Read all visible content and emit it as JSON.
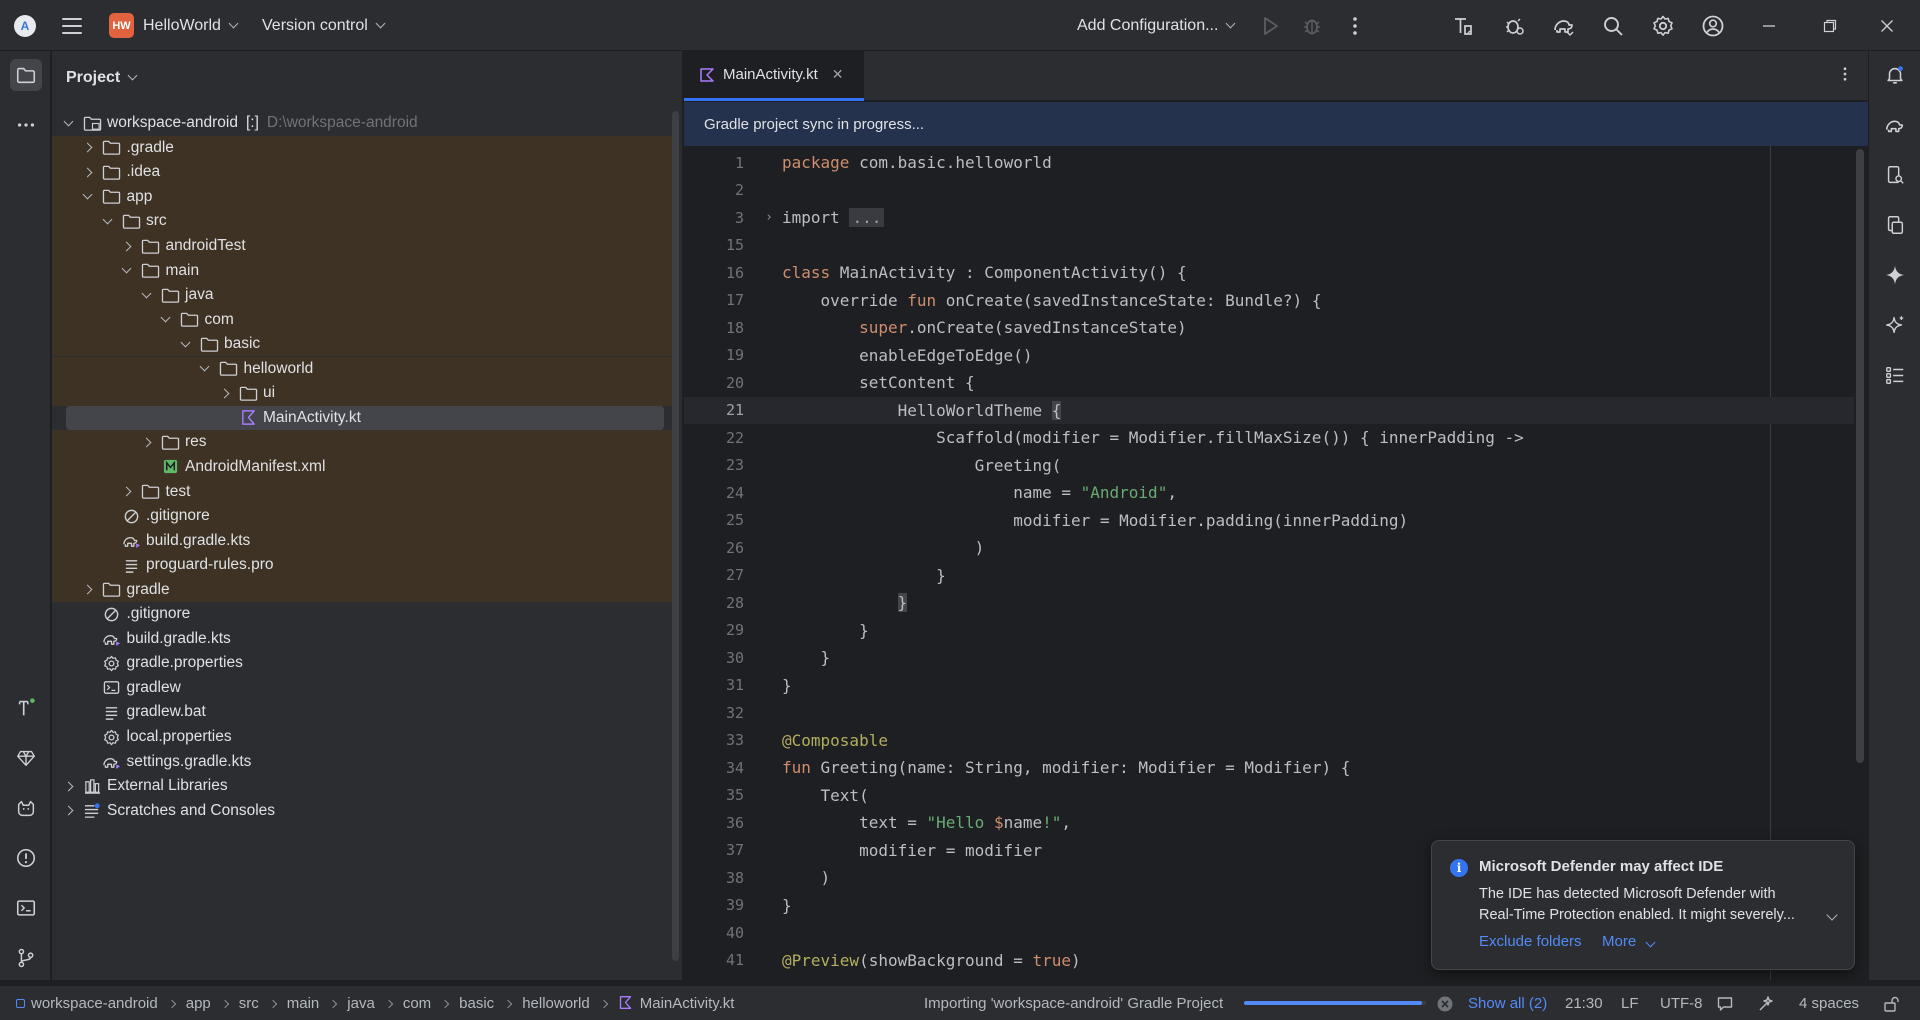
{
  "titlebar": {
    "project_badge": "HW",
    "project_name": "HelloWorld",
    "vcs_label": "Version control",
    "run_config": "Add Configuration..."
  },
  "project_panel": {
    "title": "Project",
    "tree": [
      {
        "label": "workspace-android",
        "suffix": "[:]",
        "hint": "D:\\workspace-android",
        "depth": 0,
        "expanded": true,
        "icon": "module-folder-icon",
        "brown": false
      },
      {
        "label": ".gradle",
        "depth": 1,
        "expanded": false,
        "icon": "folder-icon",
        "brown": true
      },
      {
        "label": ".idea",
        "depth": 1,
        "expanded": false,
        "icon": "folder-icon",
        "brown": true
      },
      {
        "label": "app",
        "depth": 1,
        "expanded": true,
        "icon": "folder-icon",
        "brown": true
      },
      {
        "label": "src",
        "depth": 2,
        "expanded": true,
        "icon": "folder-icon",
        "brown": true
      },
      {
        "label": "androidTest",
        "depth": 3,
        "expanded": false,
        "icon": "folder-icon",
        "brown": true
      },
      {
        "label": "main",
        "depth": 3,
        "expanded": true,
        "icon": "folder-icon",
        "brown": true
      },
      {
        "label": "java",
        "depth": 4,
        "expanded": true,
        "icon": "folder-icon",
        "brown": true
      },
      {
        "label": "com",
        "depth": 5,
        "expanded": true,
        "icon": "folder-icon",
        "brown": true
      },
      {
        "label": "basic",
        "depth": 6,
        "expanded": true,
        "icon": "folder-icon",
        "brown": true
      },
      {
        "label": "helloworld",
        "depth": 7,
        "expanded": true,
        "icon": "folder-icon",
        "brown": true
      },
      {
        "label": "ui",
        "depth": 8,
        "expanded": false,
        "icon": "folder-icon",
        "brown": true
      },
      {
        "label": "MainActivity.kt",
        "depth": 8,
        "leaf": true,
        "icon": "kotlin-file-icon",
        "brown": true,
        "selected": true
      },
      {
        "label": "res",
        "depth": 4,
        "expanded": false,
        "icon": "folder-icon",
        "brown": true
      },
      {
        "label": "AndroidManifest.xml",
        "depth": 4,
        "leaf": true,
        "icon": "manifest-file-icon",
        "brown": true
      },
      {
        "label": "test",
        "depth": 3,
        "expanded": false,
        "icon": "folder-icon",
        "brown": true
      },
      {
        "label": ".gitignore",
        "depth": 2,
        "leaf": true,
        "icon": "ignore-file-icon",
        "brown": true
      },
      {
        "label": "build.gradle.kts",
        "depth": 2,
        "leaf": true,
        "icon": "gradle-file-icon",
        "brown": true
      },
      {
        "label": "proguard-rules.pro",
        "depth": 2,
        "leaf": true,
        "icon": "text-file-icon",
        "brown": true
      },
      {
        "label": "gradle",
        "depth": 1,
        "expanded": false,
        "icon": "folder-icon",
        "brown": true
      },
      {
        "label": ".gitignore",
        "depth": 1,
        "leaf": true,
        "icon": "ignore-file-icon",
        "brown": false
      },
      {
        "label": "build.gradle.kts",
        "depth": 1,
        "leaf": true,
        "icon": "gradle-file-icon",
        "brown": false
      },
      {
        "label": "gradle.properties",
        "depth": 1,
        "leaf": true,
        "icon": "settings-file-icon",
        "brown": false
      },
      {
        "label": "gradlew",
        "depth": 1,
        "leaf": true,
        "icon": "terminal-file-icon",
        "brown": false
      },
      {
        "label": "gradlew.bat",
        "depth": 1,
        "leaf": true,
        "icon": "text-file-icon",
        "brown": false
      },
      {
        "label": "local.properties",
        "depth": 1,
        "leaf": true,
        "icon": "settings-file-icon",
        "brown": false
      },
      {
        "label": "settings.gradle.kts",
        "depth": 1,
        "leaf": true,
        "icon": "gradle-file-icon",
        "brown": false
      },
      {
        "label": "External Libraries",
        "depth": 0,
        "expanded": false,
        "icon": "libraries-icon",
        "brown": false
      },
      {
        "label": "Scratches and Consoles",
        "depth": 0,
        "expanded": false,
        "icon": "scratches-icon",
        "brown": false
      }
    ]
  },
  "editor": {
    "tab_label": "MainActivity.kt",
    "banner": "Gradle project sync in progress...",
    "current_line": "21",
    "lines": [
      {
        "n": "1",
        "parts": [
          [
            "kw",
            "package"
          ],
          [
            "t",
            " com.basic.helloworld"
          ]
        ]
      },
      {
        "n": "2",
        "parts": []
      },
      {
        "n": "3",
        "fold": true,
        "parts": [
          [
            "t",
            "import "
          ],
          [
            "fold",
            "..."
          ]
        ]
      },
      {
        "n": "15",
        "parts": []
      },
      {
        "n": "16",
        "parts": [
          [
            "kw",
            "class"
          ],
          [
            "t",
            " MainActivity : ComponentActivity() {"
          ]
        ]
      },
      {
        "n": "17",
        "parts": [
          [
            "t",
            "    override "
          ],
          [
            "kw",
            "fun"
          ],
          [
            "t",
            " onCreate(savedInstanceState: Bundle?) {"
          ]
        ]
      },
      {
        "n": "18",
        "parts": [
          [
            "t",
            "        "
          ],
          [
            "kw",
            "super"
          ],
          [
            "t",
            ".onCreate(savedInstanceState)"
          ]
        ]
      },
      {
        "n": "19",
        "parts": [
          [
            "t",
            "        enableEdgeToEdge()"
          ]
        ]
      },
      {
        "n": "20",
        "parts": [
          [
            "t",
            "        setContent {"
          ]
        ]
      },
      {
        "n": "21",
        "parts": [
          [
            "t",
            "            HelloWorldTheme "
          ],
          [
            "hl",
            "{"
          ]
        ]
      },
      {
        "n": "22",
        "parts": [
          [
            "t",
            "                Scaffold(modifier = Modifier.fillMaxSize()) { innerPadding ->"
          ]
        ]
      },
      {
        "n": "23",
        "parts": [
          [
            "t",
            "                    Greeting("
          ]
        ]
      },
      {
        "n": "24",
        "parts": [
          [
            "t",
            "                        name = "
          ],
          [
            "str",
            "\"Android\""
          ],
          [
            "t",
            ","
          ]
        ]
      },
      {
        "n": "25",
        "parts": [
          [
            "t",
            "                        modifier = Modifier.padding(innerPadding)"
          ]
        ]
      },
      {
        "n": "26",
        "parts": [
          [
            "t",
            "                    )"
          ]
        ]
      },
      {
        "n": "27",
        "parts": [
          [
            "t",
            "                }"
          ]
        ]
      },
      {
        "n": "28",
        "parts": [
          [
            "t",
            "            "
          ],
          [
            "hl",
            "}"
          ]
        ]
      },
      {
        "n": "29",
        "parts": [
          [
            "t",
            "        }"
          ]
        ]
      },
      {
        "n": "30",
        "parts": [
          [
            "t",
            "    }"
          ]
        ]
      },
      {
        "n": "31",
        "parts": [
          [
            "t",
            "}"
          ]
        ]
      },
      {
        "n": "32",
        "parts": []
      },
      {
        "n": "33",
        "parts": [
          [
            "ann",
            "@Composable"
          ]
        ]
      },
      {
        "n": "34",
        "parts": [
          [
            "kw",
            "fun"
          ],
          [
            "t",
            " Greeting(name: String, modifier: Modifier = Modifier) {"
          ]
        ]
      },
      {
        "n": "35",
        "parts": [
          [
            "t",
            "    Text("
          ]
        ]
      },
      {
        "n": "36",
        "parts": [
          [
            "t",
            "        text = "
          ],
          [
            "str",
            "\"Hello "
          ],
          [
            "kw",
            "$"
          ],
          [
            "t",
            "name"
          ],
          [
            "str",
            "!\""
          ],
          [
            "t",
            ","
          ]
        ]
      },
      {
        "n": "37",
        "parts": [
          [
            "t",
            "        modifier = modifier"
          ]
        ]
      },
      {
        "n": "38",
        "parts": [
          [
            "t",
            "    )"
          ]
        ]
      },
      {
        "n": "39",
        "parts": [
          [
            "t",
            "}"
          ]
        ]
      },
      {
        "n": "40",
        "parts": []
      },
      {
        "n": "41",
        "parts": [
          [
            "ann",
            "@Preview"
          ],
          [
            "t",
            "(showBackground = "
          ],
          [
            "kw",
            "true"
          ],
          [
            "t",
            ")"
          ]
        ]
      }
    ]
  },
  "notification": {
    "title": "Microsoft Defender may affect IDE",
    "body": "The IDE has detected Microsoft Defender with Real-Time Protection enabled. It might severely...",
    "action_primary": "Exclude folders",
    "action_more": "More"
  },
  "statusbar": {
    "breadcrumbs": [
      "workspace-android",
      "app",
      "src",
      "main",
      "java",
      "com",
      "basic",
      "helloworld",
      "MainActivity.kt"
    ],
    "task": "Importing 'workspace-android' Gradle Project",
    "progress": 0.98,
    "show_all": "Show all (2)",
    "position": "21:30",
    "line_sep": "LF",
    "encoding": "UTF-8",
    "indent": "4 spaces"
  },
  "colors": {
    "accent": "#3574f0",
    "brown_highlight": "#3d3223",
    "background": "#1e1f22",
    "panel": "#2b2d30"
  }
}
